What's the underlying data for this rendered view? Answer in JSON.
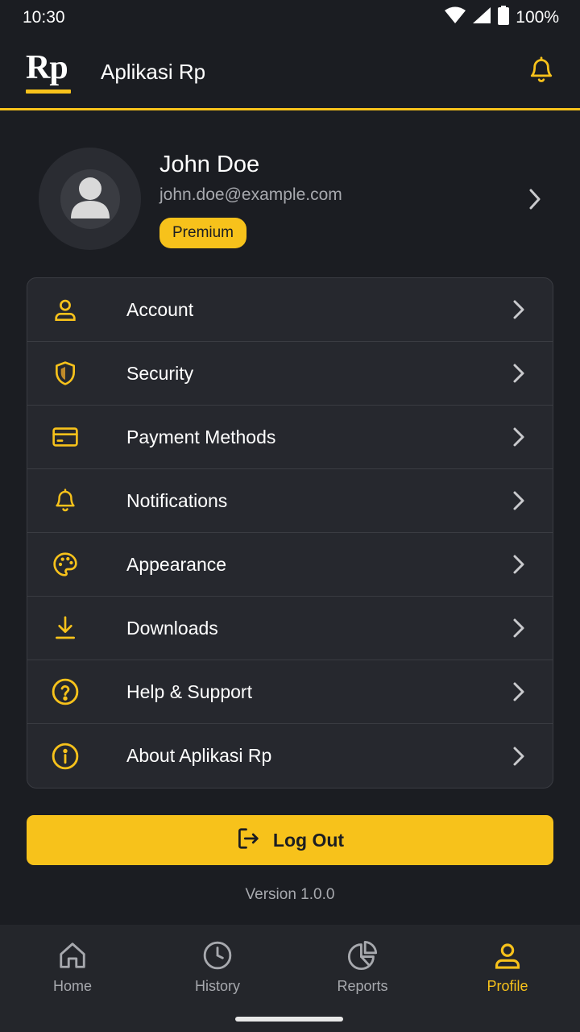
{
  "status": {
    "time": "10:30",
    "battery": "100%"
  },
  "app": {
    "logo_text": "Rp",
    "title": "Aplikasi Rp"
  },
  "profile": {
    "name": "John Doe",
    "email": "john.doe@example.com",
    "badge": "Premium"
  },
  "menu": [
    {
      "label": "Account",
      "icon": "user-icon"
    },
    {
      "label": "Security",
      "icon": "shield-icon"
    },
    {
      "label": "Payment Methods",
      "icon": "credit-card-icon"
    },
    {
      "label": "Notifications",
      "icon": "bell-icon"
    },
    {
      "label": "Appearance",
      "icon": "palette-icon"
    },
    {
      "label": "Downloads",
      "icon": "download-icon"
    },
    {
      "label": "Help & Support",
      "icon": "help-circle-icon"
    },
    {
      "label": "About Aplikasi Rp",
      "icon": "info-circle-icon"
    }
  ],
  "logout": {
    "label": "Log Out"
  },
  "version": "Version 1.0.0",
  "nav": [
    {
      "label": "Home",
      "icon": "home-icon",
      "active": false
    },
    {
      "label": "History",
      "icon": "clock-icon",
      "active": false
    },
    {
      "label": "Reports",
      "icon": "pie-chart-icon",
      "active": false
    },
    {
      "label": "Profile",
      "icon": "user-icon",
      "active": true
    }
  ],
  "colors": {
    "accent": "#f7c21b",
    "background": "#1b1d22",
    "card": "#26282e",
    "muted": "#a7a9ae"
  }
}
